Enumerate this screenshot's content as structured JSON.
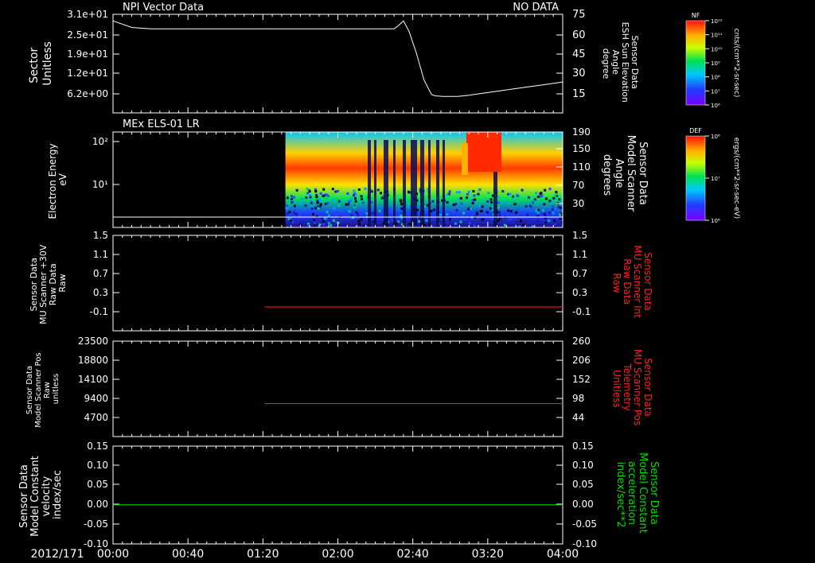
{
  "colors": {
    "background": "#000000",
    "axis": "#ffffff",
    "red": "#ff2020",
    "green": "#00dd00"
  },
  "chart_data": [
    {
      "type": "line",
      "title": "NPI Vector Data",
      "status": "NO DATA",
      "ylabel_left": [
        "Sector",
        "Unitless"
      ],
      "yticks_left": [
        "3.1e+01",
        "2.5e+01",
        "1.9e+01",
        "1.2e+01",
        "6.2e+00"
      ],
      "ylabel_right": [
        "Sensor Data",
        "ESH Sun Elevation",
        "Angle",
        "degree"
      ],
      "yticks_right": [
        "75",
        "60",
        "45",
        "30",
        "15"
      ],
      "ylim_right": [
        0,
        75
      ],
      "series": [
        {
          "color": "#ffffff",
          "x": [
            0,
            10,
            20,
            40,
            60,
            80,
            100,
            150,
            152,
            155,
            158,
            162,
            166,
            170,
            172,
            176,
            180,
            184,
            190,
            200,
            215,
            230,
            240
          ],
          "values": [
            70,
            65,
            64,
            64,
            64,
            64,
            64,
            64,
            66,
            70,
            62,
            45,
            25,
            14,
            13,
            12.5,
            12.5,
            12.5,
            13.5,
            15.5,
            18.5,
            21.5,
            23.5
          ]
        }
      ]
    },
    {
      "type": "heatmap",
      "title": "MEx ELS-01 LR",
      "ylabel_left": [
        "Electron Energy",
        "eV"
      ],
      "yticks_left": [
        "10²",
        "10¹"
      ],
      "ylabel_right": [
        "Sensor Data",
        "Model Scanner",
        "Angle",
        "degrees"
      ],
      "yticks_right": [
        "190",
        "150",
        "110",
        "70",
        "30"
      ],
      "ylim_right": [
        0,
        190
      ],
      "data_start_minutes": 92
    },
    {
      "type": "line",
      "ylabel_left": [
        "Sensor Data",
        "MU Scanner +30V",
        "Raw Data",
        "Raw"
      ],
      "yticks_left": [
        "1.5",
        "1.1",
        "0.7",
        "0.3",
        "-0.1"
      ],
      "ylabel_right": [
        "Sensor Data",
        "MU Scanner Int",
        "Raw Data",
        "Raw"
      ],
      "yticks_right": [
        "1.5",
        "1.1",
        "0.7",
        "0.3",
        "-0.1"
      ],
      "ylim": [
        -0.5,
        1.5
      ],
      "series": [
        {
          "color": "#ff2020",
          "x": [
            81,
            240
          ],
          "values": [
            0.0,
            0.0
          ]
        }
      ]
    },
    {
      "type": "line",
      "ylabel_left": [
        "Sensor Data",
        "Model Scanner Pos",
        "Raw",
        "unitless"
      ],
      "yticks_left": [
        "23500",
        "18800",
        "14100",
        "9400",
        "4700"
      ],
      "ylabel_right": [
        "Sensor Data",
        "MU Scanner Pos",
        "Telemetry",
        "Unitless"
      ],
      "yticks_right": [
        "260",
        "206",
        "152",
        "98",
        "44"
      ],
      "ylim_right": [
        0,
        260
      ],
      "series": [
        {
          "color": "#ff2020",
          "x": [
            81,
            240
          ],
          "values": [
            90,
            90
          ]
        }
      ]
    },
    {
      "type": "line",
      "ylabel_left": [
        "Sensor Data",
        "Model Constant",
        "velocity",
        "index/sec"
      ],
      "yticks_left": [
        "0.15",
        "0.10",
        "0.05",
        "0.00",
        "-0.05",
        "-0.10"
      ],
      "ylabel_right": [
        "Sensor Data",
        "Model Constant",
        "acceleration",
        "index/sec**2"
      ],
      "yticks_right": [
        "0.15",
        "0.10",
        "0.05",
        "0.00",
        "-0.05",
        "-0.10"
      ],
      "ylim": [
        -0.1,
        0.15
      ],
      "series": [
        {
          "color": "#00dd00",
          "x": [
            0,
            240
          ],
          "values": [
            0.0,
            0.0
          ]
        }
      ]
    }
  ],
  "time_axis": {
    "date": "2012/171",
    "ticks": [
      "00:00",
      "00:40",
      "01:20",
      "02:00",
      "02:40",
      "03:20",
      "04:00"
    ]
  },
  "colorbars": [
    {
      "name": "NF",
      "ticks": [
        "10¹²",
        "10¹¹",
        "10¹⁰",
        "10⁹",
        "10⁸",
        "10⁷",
        "10⁶"
      ],
      "unit": "cnts/(cm**2-sr-sec)"
    },
    {
      "name": "DEF",
      "ticks": [
        "10⁸",
        "10⁷",
        "10⁶"
      ],
      "unit": "ergs/(cm**2-sr-sec-eV)"
    }
  ]
}
